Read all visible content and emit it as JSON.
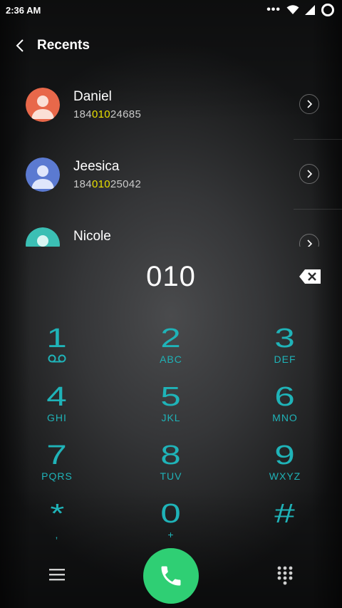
{
  "status_bar": {
    "time": "2:36 AM",
    "more": "•••"
  },
  "header": {
    "title": "Recents"
  },
  "contacts": [
    {
      "name": "Daniel",
      "number_prefix": "184",
      "number_match": "010",
      "number_suffix": "24685",
      "avatar_color": "#e8684a"
    },
    {
      "name": "Jeesica",
      "number_prefix": "184",
      "number_match": "010",
      "number_suffix": "25042",
      "avatar_color": "#5b7ad1"
    },
    {
      "name": "Nicole",
      "number_prefix": "",
      "number_match": "",
      "number_suffix": "",
      "avatar_color": "#3bbfb4"
    }
  ],
  "dialed": "010",
  "keypad": [
    {
      "digit": "1",
      "letters": ""
    },
    {
      "digit": "2",
      "letters": "ABC"
    },
    {
      "digit": "3",
      "letters": "DEF"
    },
    {
      "digit": "4",
      "letters": "GHI"
    },
    {
      "digit": "5",
      "letters": "JKL"
    },
    {
      "digit": "6",
      "letters": "MNO"
    },
    {
      "digit": "7",
      "letters": "PQRS"
    },
    {
      "digit": "8",
      "letters": "TUV"
    },
    {
      "digit": "9",
      "letters": "WXYZ"
    },
    {
      "digit": "*",
      "letters": ","
    },
    {
      "digit": "0",
      "letters": "+"
    },
    {
      "digit": "#",
      "letters": ""
    }
  ],
  "colors": {
    "accent": "#1fb3b8",
    "call": "#2fcf74",
    "highlight": "#e9e000"
  }
}
